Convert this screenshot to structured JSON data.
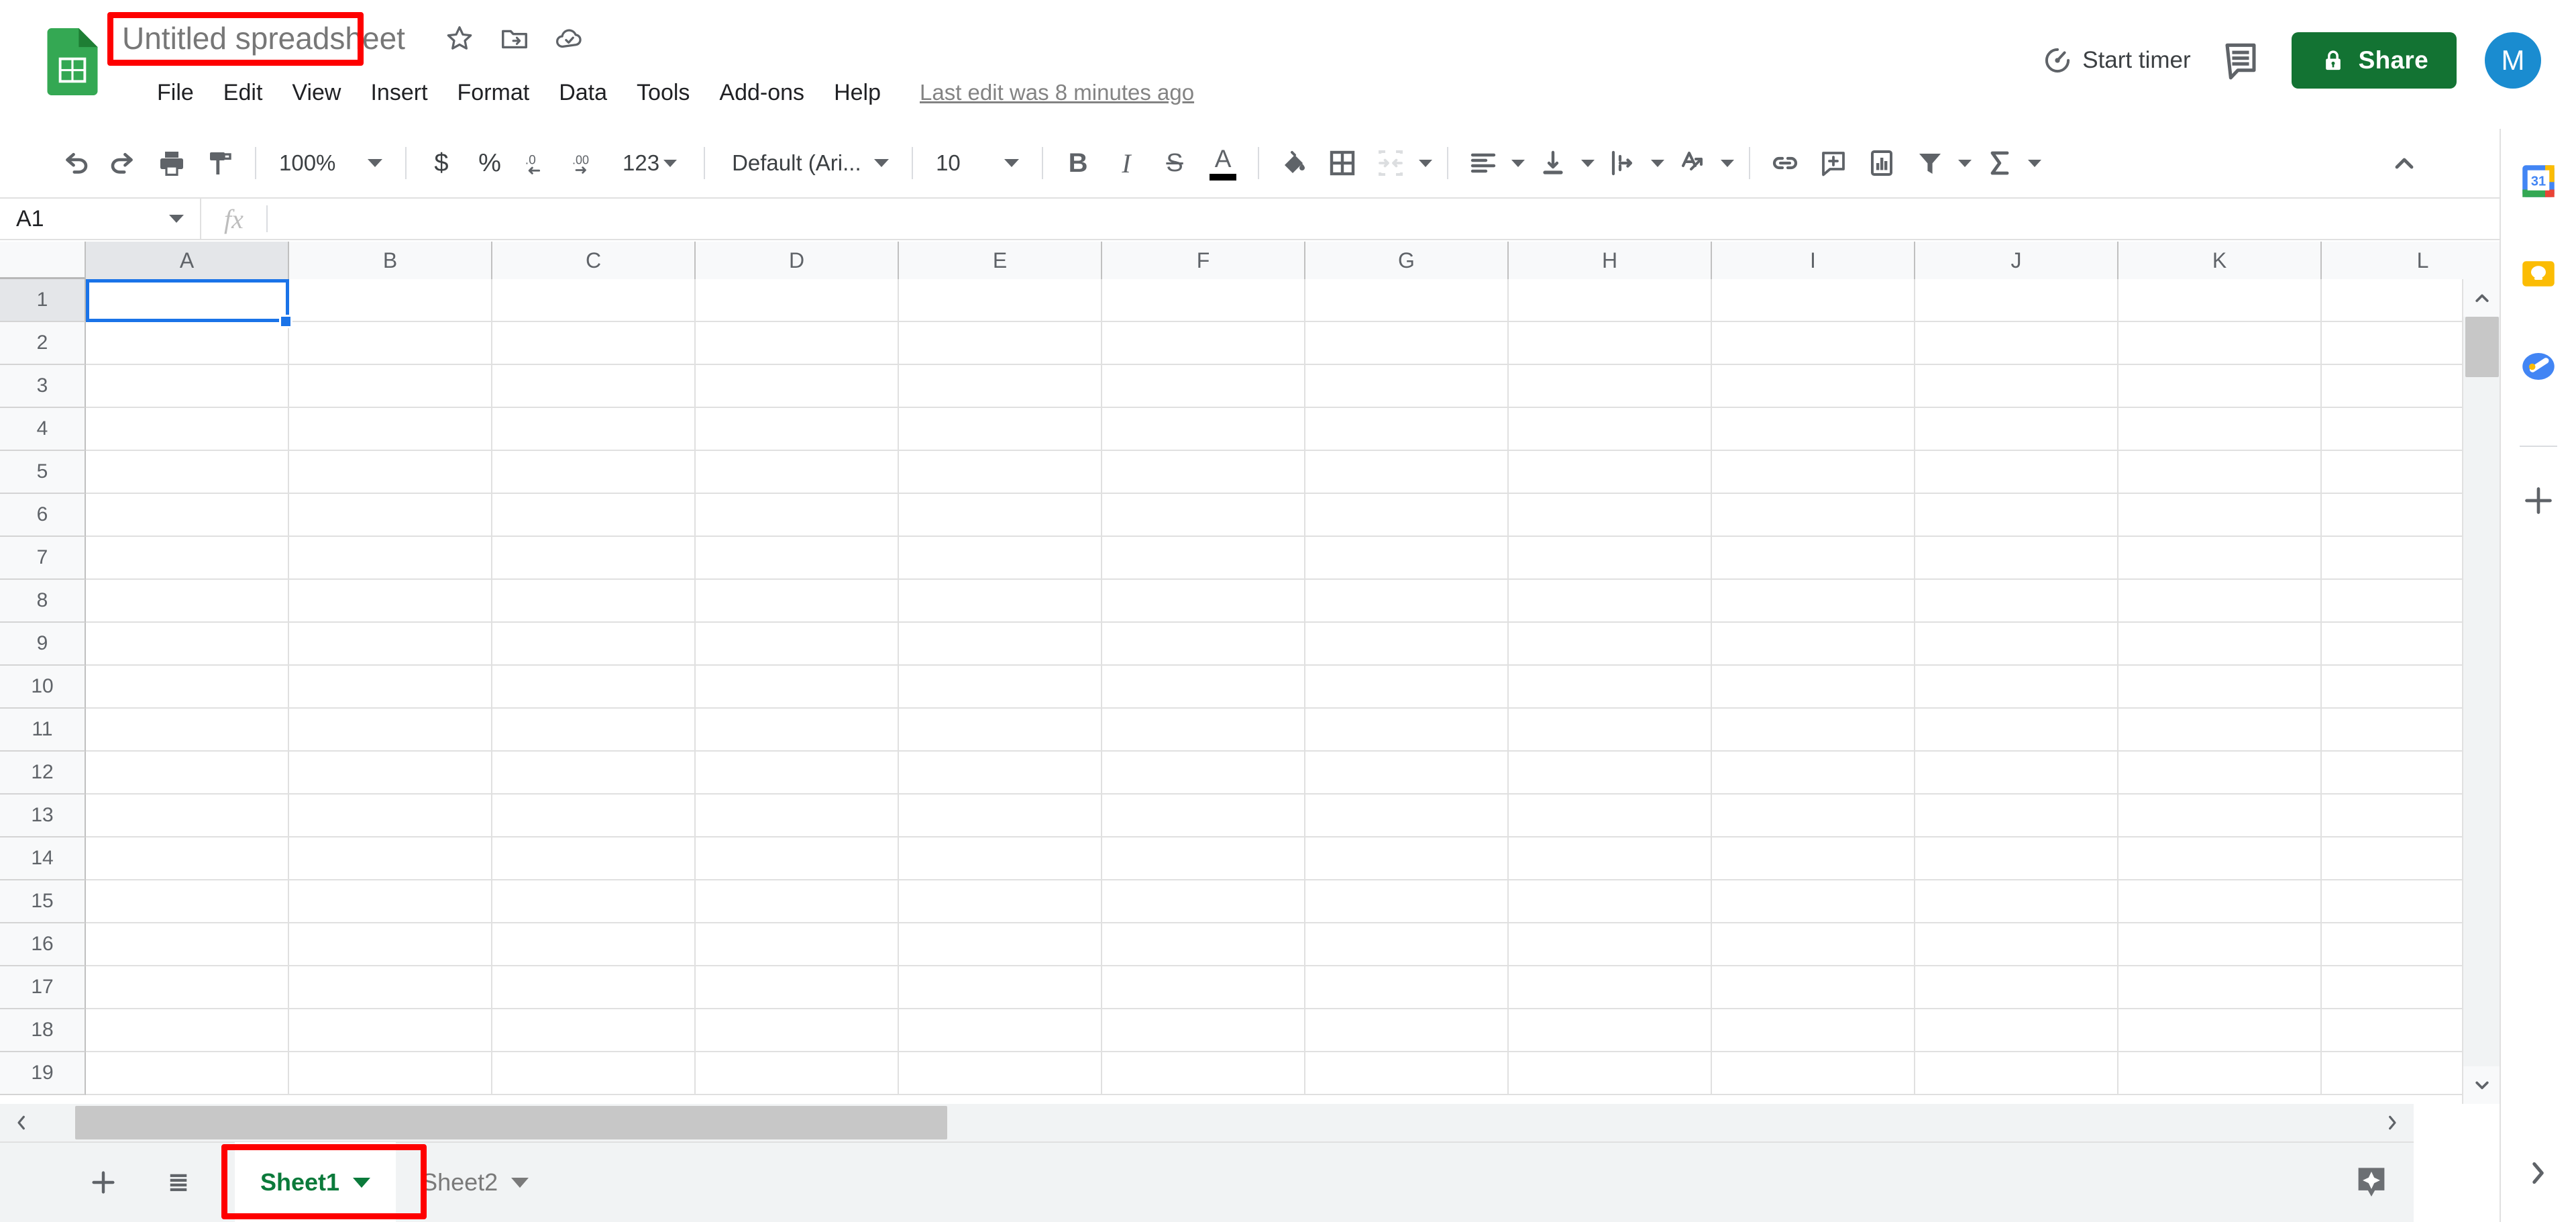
{
  "app": {
    "product": "Google Sheets",
    "logo_icon": "sheets-logo-icon"
  },
  "header": {
    "doc_title": "Untitled spreadsheet",
    "title_icons": [
      {
        "name": "star-icon",
        "label": "Star"
      },
      {
        "name": "move-to-folder-icon",
        "label": "Move"
      },
      {
        "name": "cloud-saved-icon",
        "label": "Document status"
      }
    ],
    "menus": [
      "File",
      "Edit",
      "View",
      "Insert",
      "Format",
      "Data",
      "Tools",
      "Add-ons",
      "Help"
    ],
    "last_edit": "Last edit was 8 minutes ago",
    "start_timer_label": "Start timer",
    "comment_icon": "comment-icon",
    "share_label": "Share",
    "share_lock_icon": "lock-icon",
    "share_color": "#137333",
    "avatar_initial": "M",
    "avatar_color": "#1a8cd0"
  },
  "toolbar": {
    "undo": "undo-icon",
    "redo": "redo-icon",
    "print": "print-icon",
    "paint_format": "paint-format-icon",
    "zoom_value": "100%",
    "currency": "$",
    "percent": "%",
    "decrease_decimal": ".0",
    "increase_decimal": ".00",
    "number_format": "123",
    "font_family": "Default (Ari...",
    "font_size": "10",
    "bold": "B",
    "italic": "I",
    "strikethrough": "S",
    "text_color": "A",
    "text_color_swatch": "#000000",
    "fill_color": "fill-color-icon",
    "borders": "borders-icon",
    "merge_cells": "merge-cells-icon",
    "horizontal_align": "horizontal-align-icon",
    "vertical_align": "vertical-align-icon",
    "text_wrapping": "text-wrapping-icon",
    "text_rotation": "text-rotation-icon",
    "insert_link": "insert-link-icon",
    "insert_comment": "insert-comment-icon",
    "insert_chart": "insert-chart-icon",
    "filter": "filter-icon",
    "functions": "sigma-icon",
    "collapse": "chevron-up-icon"
  },
  "formula_bar": {
    "name_box_value": "A1",
    "fx_label": "fx",
    "formula_value": ""
  },
  "grid": {
    "columns": [
      "A",
      "B",
      "C",
      "D",
      "E",
      "F",
      "G",
      "H",
      "I",
      "J",
      "K",
      "L"
    ],
    "rows": [
      1,
      2,
      3,
      4,
      5,
      6,
      7,
      8,
      9,
      10,
      11,
      12,
      13,
      14,
      15,
      16,
      17,
      18,
      19
    ],
    "selected_cell": "A1",
    "selected_column": "A",
    "selected_row": 1,
    "selection_color": "#1a73e8",
    "cell_values": []
  },
  "sheet_tabs": {
    "add_sheet_icon": "plus-icon",
    "all_sheets_icon": "all-sheets-icon",
    "tabs": [
      {
        "label": "Sheet1",
        "active": true
      },
      {
        "label": "Sheet2",
        "active": false
      }
    ],
    "active_color": "#0b7a3b",
    "explore_icon": "explore-icon"
  },
  "sidebar": {
    "items": [
      {
        "name": "google-calendar-icon",
        "label": "Calendar",
        "badge": "31"
      },
      {
        "name": "google-keep-icon",
        "label": "Keep"
      },
      {
        "name": "google-tasks-icon",
        "label": "Tasks"
      }
    ],
    "add_on_icon": "plus-icon",
    "expand_icon": "chevron-right-icon"
  },
  "annotations": {
    "highlight_color": "#fe0000",
    "boxes": [
      "doc-title",
      "sheet1-tab"
    ]
  },
  "scrollbars": {
    "vertical_up": "chevron-up-icon",
    "vertical_down": "chevron-down-icon",
    "horizontal_left": "chevron-left-icon",
    "horizontal_right": "chevron-right-icon"
  }
}
